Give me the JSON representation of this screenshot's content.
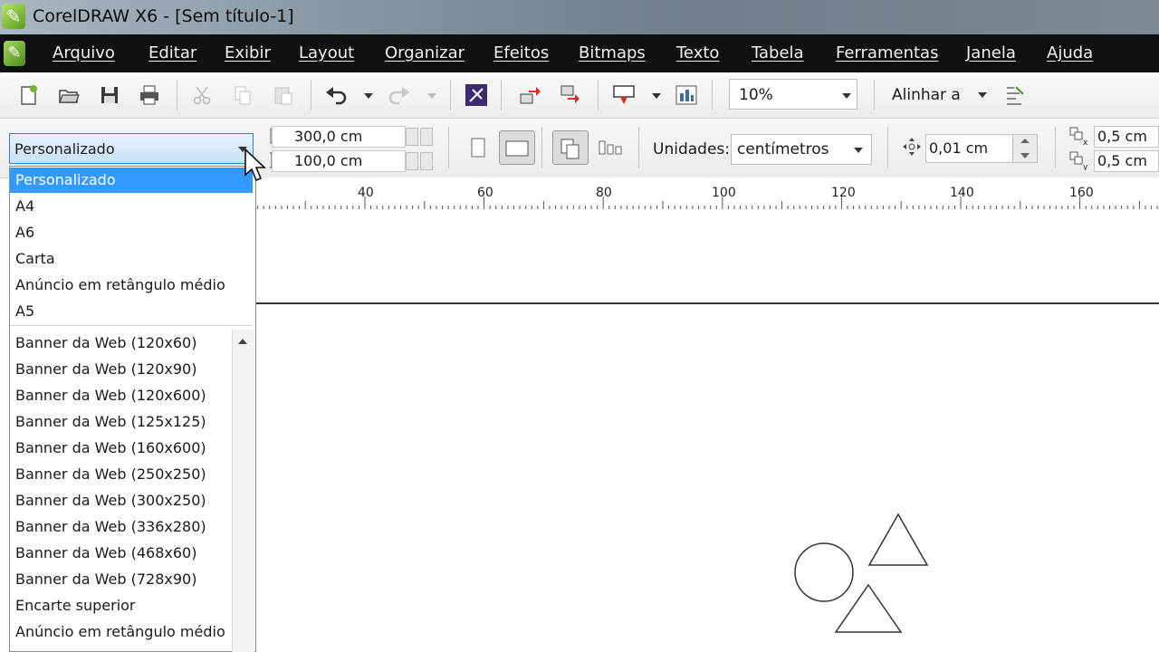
{
  "window": {
    "title": "CorelDRAW X6 - [Sem título-1]"
  },
  "menu": {
    "items": [
      "Arquivo",
      "Editar",
      "Exibir",
      "Layout",
      "Organizar",
      "Efeitos",
      "Bitmaps",
      "Texto",
      "Tabela",
      "Ferramentas",
      "Janela",
      "Ajuda"
    ]
  },
  "toolbar": {
    "zoom": "10%",
    "align_label": "Alinhar a"
  },
  "property_bar": {
    "page_preset": "Personalizado",
    "width": "300,0 cm",
    "height": "100,0 cm",
    "units_label": "Unidades:",
    "units_value": "centímetros",
    "nudge": "0,01 cm",
    "dup_x": "0,5 cm",
    "dup_y": "0,5 cm"
  },
  "ruler": {
    "ticks": [
      "40",
      "60",
      "80",
      "100",
      "120",
      "140",
      "160"
    ]
  },
  "dropdown": {
    "top_items": [
      "Personalizado",
      "A4",
      "A6",
      "Carta",
      "Anúncio em retângulo médio",
      "A5"
    ],
    "list_items": [
      "Banner da Web (120x60)",
      "Banner da Web (120x90)",
      "Banner da Web (120x600)",
      "Banner da Web (125x125)",
      "Banner da Web (160x600)",
      "Banner da Web (250x250)",
      "Banner da Web (300x250)",
      "Banner da Web (336x280)",
      "Banner da Web (468x60)",
      "Banner da Web (728x90)",
      "Encarte superior",
      "Anúncio em retângulo médio"
    ]
  },
  "colors": {
    "selection": "#3399ff",
    "menubar": "#101010",
    "accent_green": "#5a9d1c"
  },
  "icons": [
    "new-document-icon",
    "open-folder-icon",
    "save-icon",
    "print-icon",
    "cut-icon",
    "copy-icon",
    "paste-icon",
    "undo-icon",
    "redo-icon",
    "import-icon",
    "export-icon",
    "publish-icon",
    "app-launcher-icon",
    "zoom-icon",
    "portrait-icon",
    "landscape-icon",
    "all-pages-icon",
    "current-page-icon",
    "nudge-icon",
    "duplicate-distance-icon",
    "cursor-icon"
  ]
}
